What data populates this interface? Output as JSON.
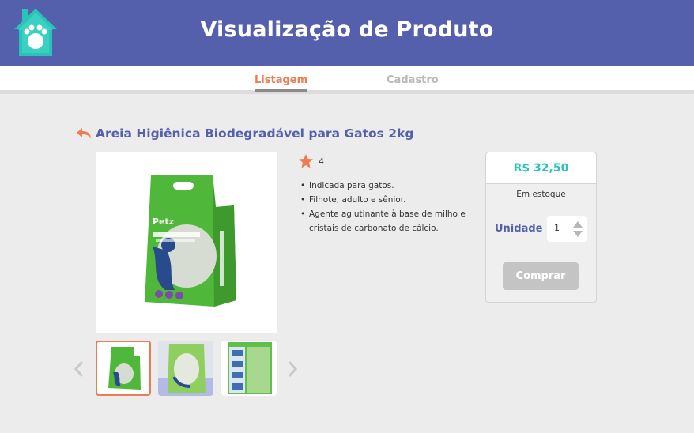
{
  "header": {
    "title": "Visualização de Produto",
    "logo_icon": "paw-house-icon"
  },
  "tabs": [
    {
      "label": "Listagem",
      "active": true
    },
    {
      "label": "Cadastro",
      "active": false
    }
  ],
  "product": {
    "title": "Areia Higiênica Biodegradável para Gatos 2kg",
    "rating": "4",
    "features": [
      "Indicada para gatos.",
      "Filhote, adulto e sênior.",
      "Agente aglutinante à base de milho e cristais de carbonato de cálcio."
    ]
  },
  "purchase": {
    "price": "R$ 32,50",
    "stock": "Em estoque",
    "unit_label": "Unidade",
    "quantity": "1",
    "buy_label": "Comprar"
  },
  "colors": {
    "header": "#5560ad",
    "accent": "#ee7b52",
    "price": "#2cc3b6",
    "bag_green": "#4fb83a"
  },
  "icons": {
    "back": "back-arrow-icon",
    "star": "star-icon",
    "prev": "chevron-left-icon",
    "next": "chevron-right-icon"
  }
}
